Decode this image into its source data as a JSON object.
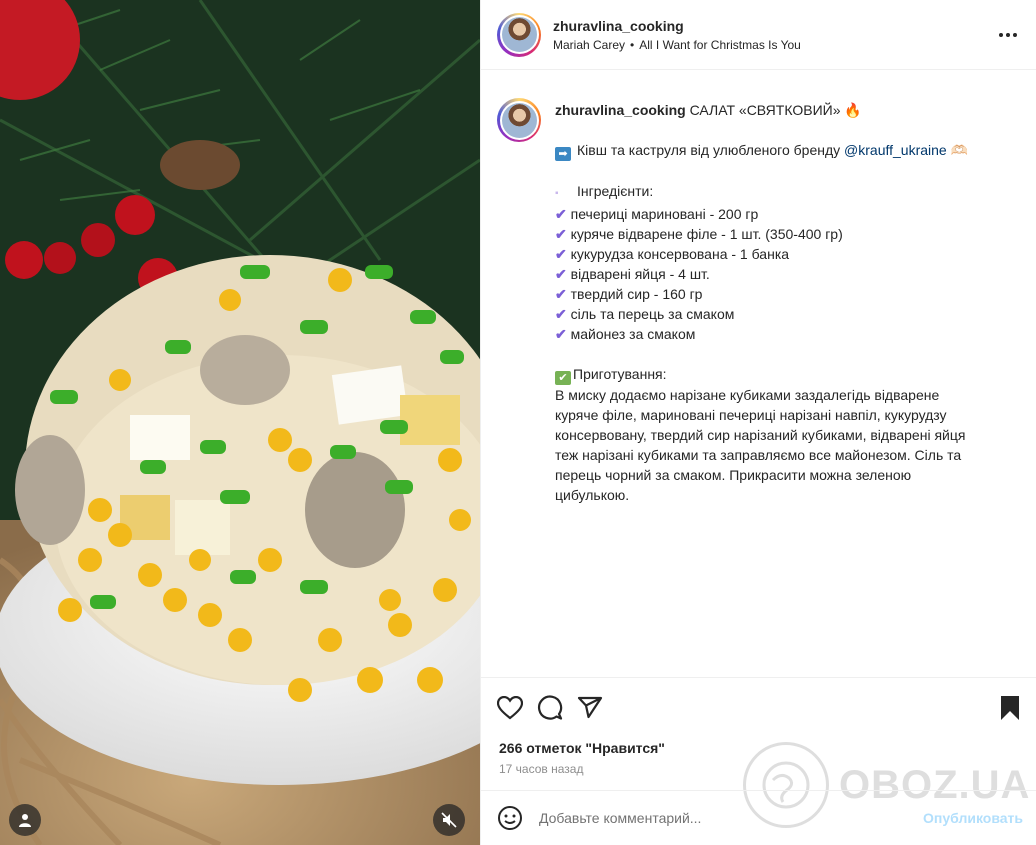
{
  "post": {
    "username": "zhuravlina_cooking",
    "music": {
      "artist": "Mariah Carey",
      "separator": "•",
      "track": "All I Want for Christmas Is You"
    },
    "more_icon": "more-horizontal-icon",
    "caption": {
      "title": "САЛАТ «СВЯТКОВИЙ» 🔥",
      "brand_line_prefix": "Ківш та каструля від улюбленого бренду ",
      "brand_mention": "@krauff_ukraine",
      "brand_emoji": "🫶🏻",
      "ingredients_heading": "Інгредієнти:",
      "ingredients": [
        "печериці мариновані - 200 гр",
        "куряче відварене філе - 1 шт. (350-400 гр)",
        "кукурудза консервована - 1 банка",
        "відварені яйця - 4 шт.",
        "твердий сир - 160 гр",
        "сіль та перець за смаком",
        "майонез за смаком"
      ],
      "prep_heading": "Приготування:",
      "prep_lines": [
        "В миску додаємо нарізане кубиками заздалегідь відварене",
        "куряче філе, мариновані печериці нарізані навпіл, кукурудзу",
        "консервовану, твердий сир нарізаний кубиками, відварені яйця",
        "теж нарізані кубиками та заправляємо все майонезом. Сіль та",
        "перець чорний за смаком. Прикрасити можна зеленою",
        "цибулькою."
      ]
    },
    "likes_text": "266 отметок \"Нравится\"",
    "time_text": "17 часов назад"
  },
  "comment": {
    "placeholder": "Добавьте комментарий...",
    "publish_label": "Опубликовать"
  },
  "watermark": {
    "text": "OBOZ.UA"
  },
  "icons": {
    "like": "heart-icon",
    "comment": "comment-icon",
    "share": "send-icon",
    "save": "bookmark-icon",
    "emoji": "smiley-icon",
    "tagged_user": "user-icon",
    "mute": "speaker-muted-icon"
  },
  "colors": {
    "link": "#00376b",
    "check": "#7b5fd6",
    "publish_disabled": "#b2dffc",
    "muted_text": "#8e8e8e"
  }
}
